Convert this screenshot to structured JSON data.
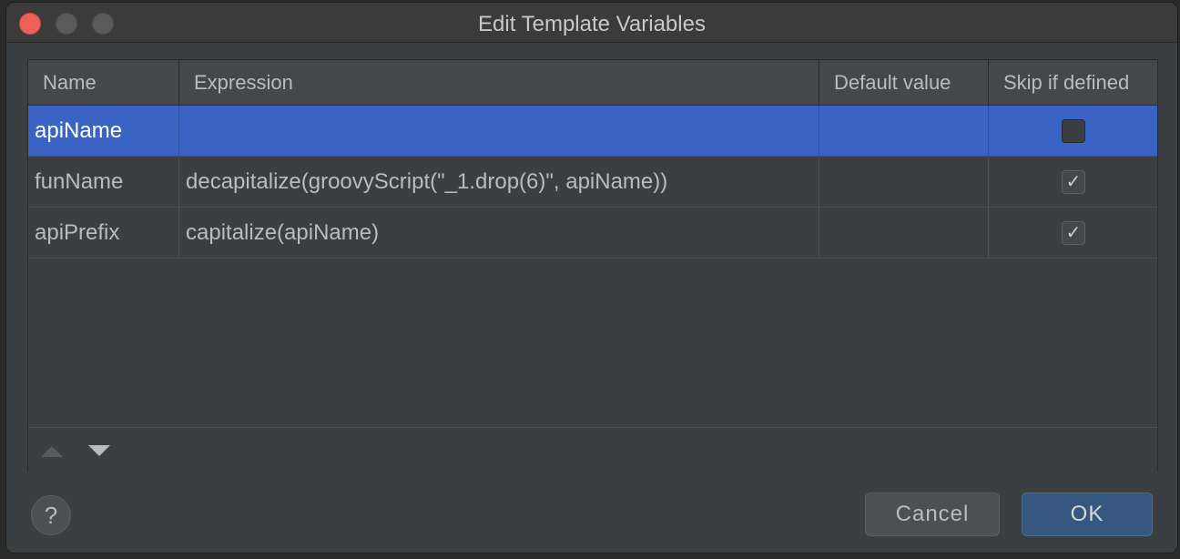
{
  "window": {
    "title": "Edit Template Variables"
  },
  "table": {
    "headers": [
      "Name",
      "Expression",
      "Default value",
      "Skip if defined"
    ],
    "rows": [
      {
        "name": "apiName",
        "expression": "",
        "default_value": "",
        "skip_if_defined": false,
        "selected": true
      },
      {
        "name": "funName",
        "expression": "decapitalize(groovyScript(\"_1.drop(6)\", apiName))",
        "default_value": "",
        "skip_if_defined": true,
        "selected": false
      },
      {
        "name": "apiPrefix",
        "expression": "capitalize(apiName)",
        "default_value": "",
        "skip_if_defined": true,
        "selected": false
      }
    ]
  },
  "toolbar": {
    "move_up_icon": "triangle-up",
    "move_down_icon": "triangle-down"
  },
  "footer": {
    "help_label": "?",
    "cancel_label": "Cancel",
    "ok_label": "OK"
  },
  "colors": {
    "selection": "#3b63c4",
    "ok_button": "#365880",
    "close": "#ed5f57"
  }
}
